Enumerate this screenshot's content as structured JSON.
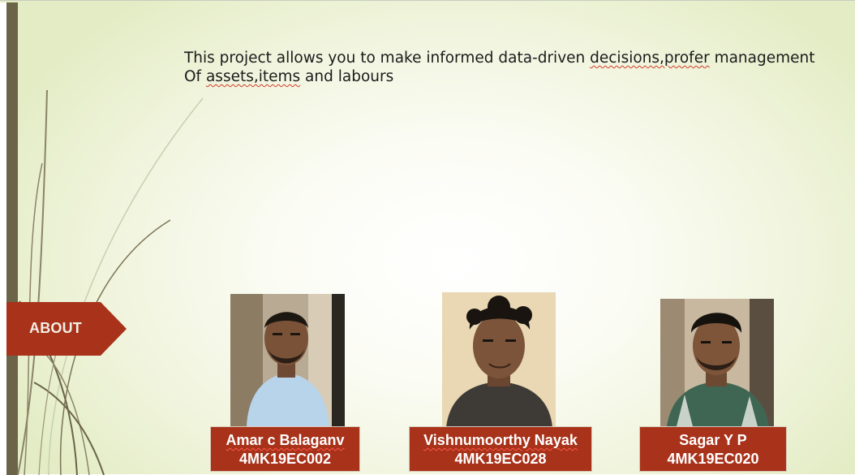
{
  "slide": {
    "intro": {
      "line1_a": "This project allows you to make informed data-driven ",
      "line1_b": "decisions,profer",
      "line1_c": " management",
      "line2_a": "Of ",
      "line2_b": "assets,items",
      "line2_c": " and labours"
    },
    "section_tag": "ABOUT",
    "team": [
      {
        "name": "Amar c Balaganv",
        "usn": "4MK19EC002",
        "photo": "portrait-photo"
      },
      {
        "name": "Vishnumoorthy Nayak",
        "usn": "4MK19EC028",
        "photo": "portrait-photo"
      },
      {
        "name": "Sagar Y P",
        "usn": "4MK19EC020",
        "photo": "portrait-photo"
      }
    ]
  },
  "colors": {
    "accent": "#a8321a",
    "bar": "#6b6448",
    "background": "#f0f4dc"
  }
}
